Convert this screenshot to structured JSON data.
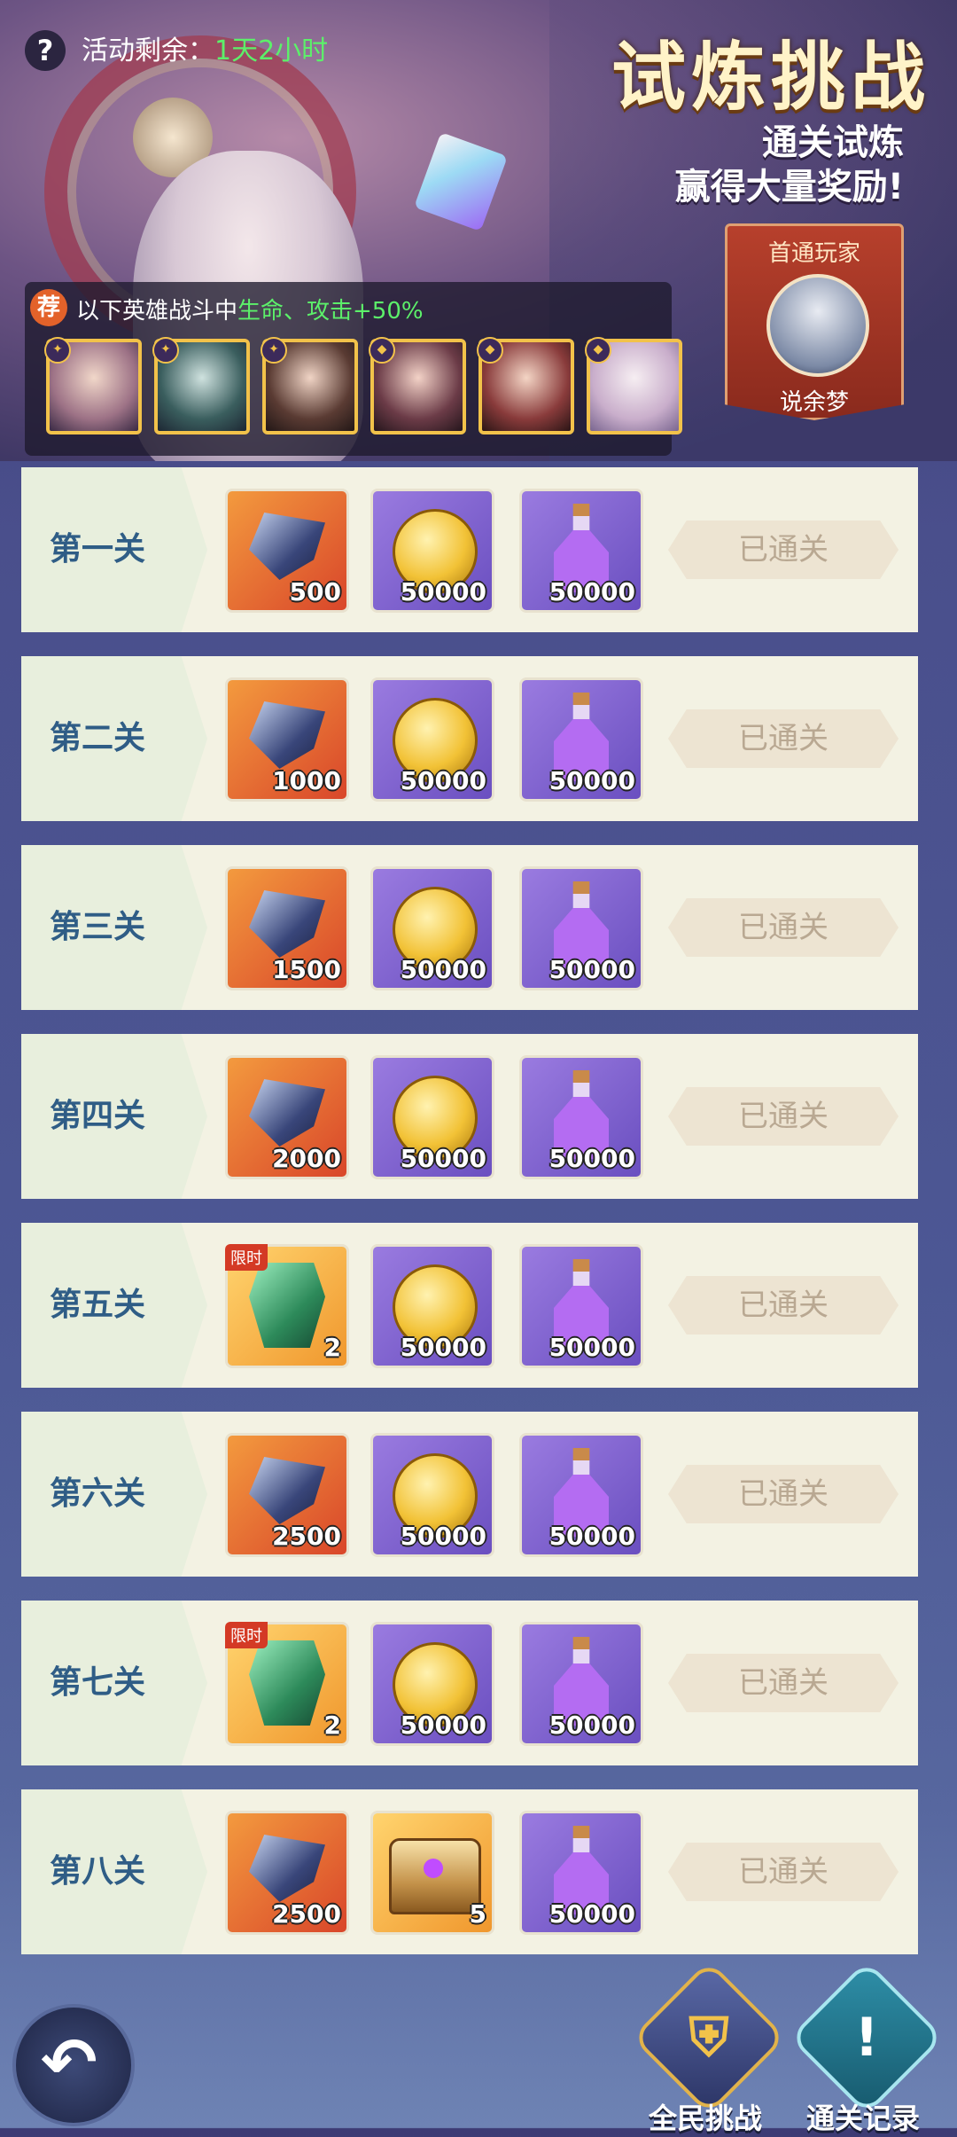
{
  "header": {
    "help_icon": "?",
    "timer_label": "活动剩余：",
    "timer_value": "1天2小时",
    "title": "试炼挑战",
    "subtitle_line1": "通关试炼",
    "subtitle_line2": "赢得大量奖励!"
  },
  "first_clear": {
    "label": "首通玩家",
    "player_name": "说余梦"
  },
  "buff": {
    "badge": "荐",
    "text_prefix": "以下英雄战斗中",
    "text_highlight": "生命、攻击+50%",
    "heroes": [
      "hero-portrait-1",
      "hero-portrait-2",
      "hero-portrait-3",
      "hero-portrait-4",
      "hero-portrait-5",
      "hero-portrait-6"
    ]
  },
  "stages": [
    {
      "name": "第一关",
      "rewards": [
        {
          "icon": "gem-icon",
          "qty": "500"
        },
        {
          "icon": "coin-icon",
          "qty": "50000"
        },
        {
          "icon": "potion-icon",
          "qty": "50000"
        }
      ],
      "status": "已通关"
    },
    {
      "name": "第二关",
      "rewards": [
        {
          "icon": "gem-icon",
          "qty": "1000"
        },
        {
          "icon": "coin-icon",
          "qty": "50000"
        },
        {
          "icon": "potion-icon",
          "qty": "50000"
        }
      ],
      "status": "已通关"
    },
    {
      "name": "第三关",
      "rewards": [
        {
          "icon": "gem-icon",
          "qty": "1500"
        },
        {
          "icon": "coin-icon",
          "qty": "50000"
        },
        {
          "icon": "potion-icon",
          "qty": "50000"
        }
      ],
      "status": "已通关"
    },
    {
      "name": "第四关",
      "rewards": [
        {
          "icon": "gem-icon",
          "qty": "2000"
        },
        {
          "icon": "coin-icon",
          "qty": "50000"
        },
        {
          "icon": "potion-icon",
          "qty": "50000"
        }
      ],
      "status": "已通关"
    },
    {
      "name": "第五关",
      "rewards": [
        {
          "icon": "token-icon",
          "qty": "2",
          "tag": "限时"
        },
        {
          "icon": "coin-icon",
          "qty": "50000"
        },
        {
          "icon": "potion-icon",
          "qty": "50000"
        }
      ],
      "status": "已通关"
    },
    {
      "name": "第六关",
      "rewards": [
        {
          "icon": "gem-icon",
          "qty": "2500"
        },
        {
          "icon": "coin-icon",
          "qty": "50000"
        },
        {
          "icon": "potion-icon",
          "qty": "50000"
        }
      ],
      "status": "已通关"
    },
    {
      "name": "第七关",
      "rewards": [
        {
          "icon": "token-icon",
          "qty": "2",
          "tag": "限时"
        },
        {
          "icon": "coin-icon",
          "qty": "50000"
        },
        {
          "icon": "potion-icon",
          "qty": "50000"
        }
      ],
      "status": "已通关"
    },
    {
      "name": "第八关",
      "rewards": [
        {
          "icon": "gem-icon",
          "qty": "2500"
        },
        {
          "icon": "chest-icon",
          "qty": "5"
        },
        {
          "icon": "potion-icon",
          "qty": "50000"
        }
      ],
      "status": "已通关"
    }
  ],
  "footer": {
    "back_icon": "↶",
    "all_challenge_label": "全民挑战",
    "all_challenge_icon": "⛨",
    "clear_record_label": "通关记录",
    "clear_record_icon": "!"
  }
}
